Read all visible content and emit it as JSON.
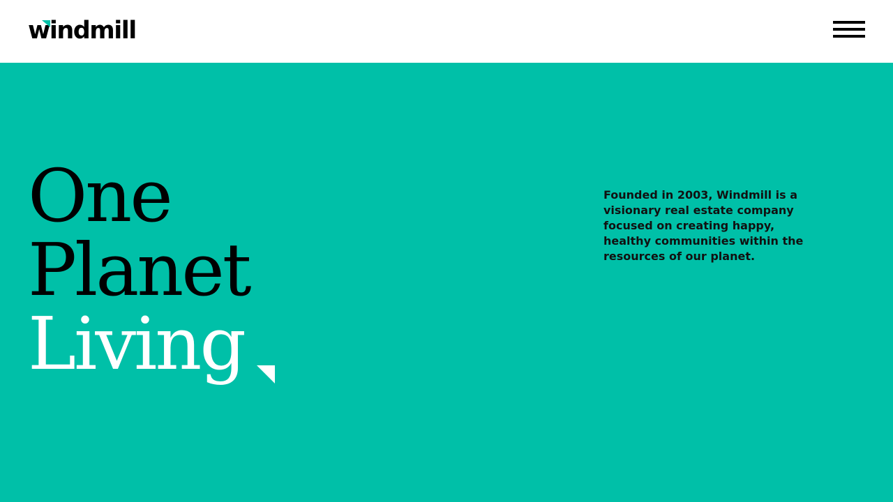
{
  "brand": {
    "name": "windmill",
    "accent_color": "#00c0a8",
    "text_color": "#000000",
    "logo_mark_icon": "teal-triangle-icon"
  },
  "header": {
    "menu_icon": "hamburger-menu-icon"
  },
  "hero": {
    "background_color": "#00c0a8",
    "title_lines": [
      "One",
      "Planet",
      "Living"
    ],
    "title_line_colors": [
      "#000000",
      "#000000",
      "#ffffff"
    ],
    "corner_mark_icon": "white-triangle-icon",
    "description": "Founded in 2003, Windmill is a visionary real estate company focused on creating happy, healthy communities within the resources of our planet."
  }
}
